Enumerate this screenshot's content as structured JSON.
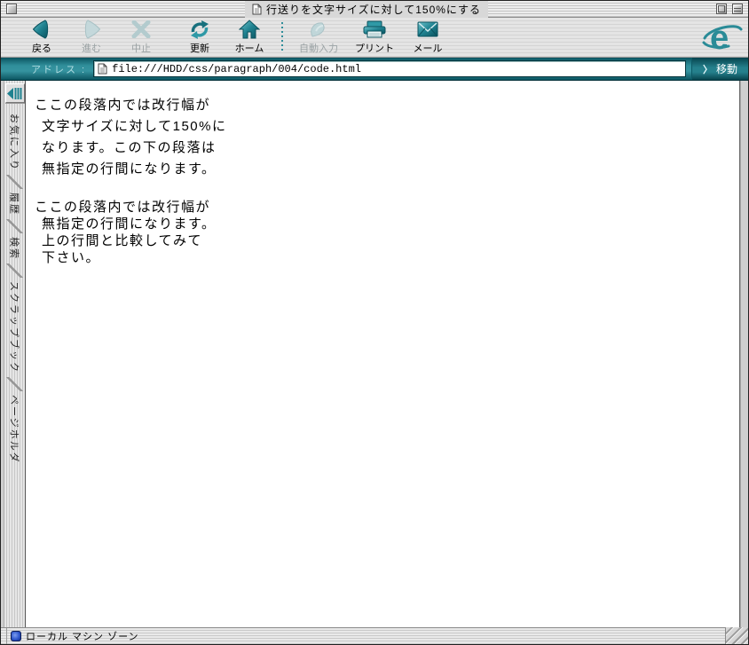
{
  "window": {
    "title": "行送りを文字サイズに対して150%にする"
  },
  "toolbar": {
    "buttons": [
      {
        "label": "戻る",
        "icon": "back-icon",
        "enabled": true
      },
      {
        "label": "進む",
        "icon": "forward-icon",
        "enabled": false
      },
      {
        "label": "中止",
        "icon": "stop-icon",
        "enabled": false
      },
      {
        "label": "更新",
        "icon": "refresh-icon",
        "enabled": true
      },
      {
        "label": "ホーム",
        "icon": "home-icon",
        "enabled": true
      },
      {
        "label": "自動入力",
        "icon": "autofill-icon",
        "enabled": false
      },
      {
        "label": "プリント",
        "icon": "print-icon",
        "enabled": true
      },
      {
        "label": "メール",
        "icon": "mail-icon",
        "enabled": true
      }
    ],
    "logo": "e"
  },
  "addressbar": {
    "label": "アドレス :",
    "url": "file:///HDD/css/paragraph/004/code.html",
    "go_chevron": "〉",
    "go_label": "移動"
  },
  "sidebar": {
    "tabs": [
      {
        "label": "お気に入り"
      },
      {
        "label": "履歴"
      },
      {
        "label": "検索"
      },
      {
        "label": "スクラップブック"
      },
      {
        "label": "ページホルダ"
      }
    ]
  },
  "content": {
    "paragraph1": [
      "ここの段落内では改行幅が",
      "文字サイズに対して150%に",
      "なります。この下の段落は",
      "無指定の行間になります。"
    ],
    "paragraph2": [
      "ここの段落内では改行幅が",
      "無指定の行間になります。",
      "上の行間と比較してみて",
      "下さい。"
    ]
  },
  "statusbar": {
    "text": "ローカル マシン ゾーン"
  },
  "colors": {
    "accent_teal": "#2E8E9A",
    "accent_teal_dark": "#0B5460",
    "disabled_icon": "#BCD3D6",
    "zone_blue": "#2A52C8"
  }
}
